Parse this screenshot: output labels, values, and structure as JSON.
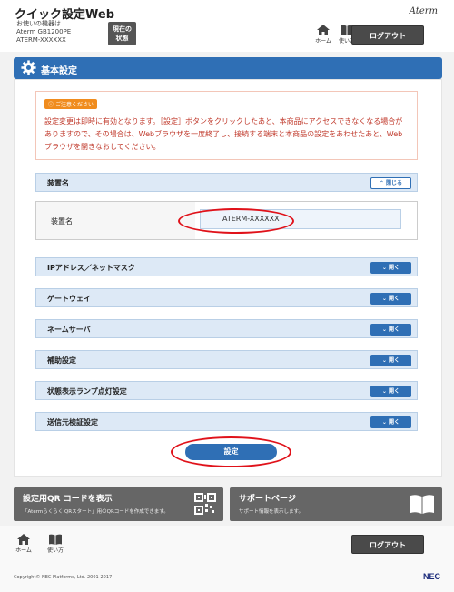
{
  "header": {
    "app_title": "クイック設定Web",
    "device_label": "お使いの機器は",
    "device_model": "Aterm GB1200PE",
    "device_name": "ATERM-XXXXXX",
    "status_button_line1": "現在の",
    "status_button_line2": "状態",
    "brand": "Aterm",
    "home_label": "ホーム",
    "help_label": "使い方",
    "logout_label": "ログアウト"
  },
  "section": {
    "title": "基本設定"
  },
  "notice": {
    "tag": "ご注意ください",
    "text": "設定変更は即時に有効となります。［設定］ボタンをクリックしたあと、本商品にアクセスできなくなる場合がありますので、その場合は、Webブラウザを一度終了し、接続する端末と本商品の設定をあわせたあと、Webブラウザを開きなおしてください。"
  },
  "device_name_section": {
    "title": "装置名",
    "close_label": "閉じる",
    "field_label": "装置名",
    "field_value": "ATERM-XXXXXX"
  },
  "accordions": [
    {
      "title": "IPアドレス／ネットマスク",
      "button": "開く"
    },
    {
      "title": "ゲートウェイ",
      "button": "開く"
    },
    {
      "title": "ネームサーバ",
      "button": "開く"
    },
    {
      "title": "補助設定",
      "button": "開く"
    },
    {
      "title": "状態表示ランプ点灯設定",
      "button": "開く"
    },
    {
      "title": "送信元検証設定",
      "button": "開く"
    }
  ],
  "submit_label": "設定",
  "tiles": {
    "qr_title": "設定用QR コードを表示",
    "qr_desc": "「Atermらくらく QRスタート」用のQRコードを作成できます。",
    "support_title": "サポートページ",
    "support_desc": "サポート情報を表示します。"
  },
  "footer": {
    "home_label": "ホーム",
    "help_label": "使い方",
    "logout_label": "ログアウト",
    "copyright": "Copyright© NEC Platforms, Ltd. 2001-2017",
    "nec_logo": "NEC"
  },
  "colors": {
    "accent": "#2f6fb5",
    "notice_text": "#c0392b",
    "highlight_oval": "#e0121a"
  }
}
